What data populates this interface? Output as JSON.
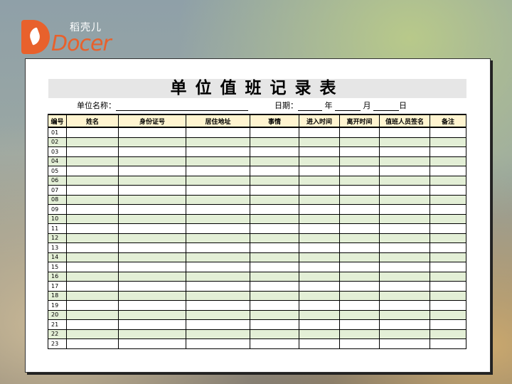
{
  "brand": {
    "name_cn": "稻壳儿",
    "name_en": "Docer"
  },
  "document": {
    "title": "单位值班记录表",
    "unit_label": "单位名称：",
    "date_label": "日期：",
    "year_label": "年",
    "month_label": "月",
    "day_label": "日"
  },
  "table": {
    "headers": [
      "编号",
      "姓名",
      "身份证号",
      "居住地址",
      "事情",
      "进入时间",
      "离开时间",
      "值班人员签名",
      "备注"
    ],
    "row_numbers": [
      "01",
      "02",
      "03",
      "04",
      "05",
      "06",
      "07",
      "08",
      "09",
      "10",
      "11",
      "12",
      "13",
      "14",
      "15",
      "16",
      "17",
      "18",
      "19",
      "20",
      "21",
      "22",
      "23"
    ]
  },
  "colors": {
    "accent": "#e8612c",
    "header_fill": "#fff4d0",
    "alt_row_fill": "#e3efd6",
    "title_fill": "#e6e6e6"
  }
}
